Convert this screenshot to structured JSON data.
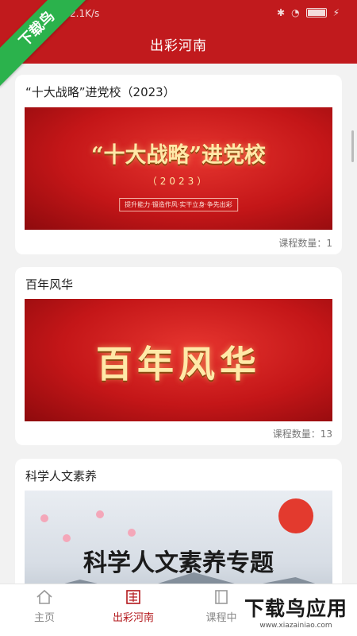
{
  "status": {
    "speed": "2.1K/s",
    "battery": "100"
  },
  "header": {
    "title": "出彩河南"
  },
  "watermark": {
    "ribbon": "下载鸟",
    "promo_main": "下载鸟应用",
    "promo_url": "www.xiazainiao.com"
  },
  "cards": [
    {
      "title": "“十大战略”进党校（2023）",
      "banner_title": "“十大战略”进党校",
      "banner_year": "（2023）",
      "banner_slogan": "提升能力·锻造作风·实干立身·争先出彩",
      "count": "课程数量：1"
    },
    {
      "title": "百年风华",
      "banner_title": "百年风华",
      "count": "课程数量：13"
    },
    {
      "title": "科学人文素养",
      "banner_title": "科学人文素养专题"
    }
  ],
  "nav": [
    {
      "label": "主页",
      "icon": "home-icon"
    },
    {
      "label": "出彩河南",
      "icon": "seal-icon"
    },
    {
      "label": "课程中",
      "icon": "book-icon"
    }
  ],
  "colors": {
    "brand_red": "#c11a1d",
    "active_nav": "#b3181c",
    "watermark_green": "#2bb24c"
  }
}
